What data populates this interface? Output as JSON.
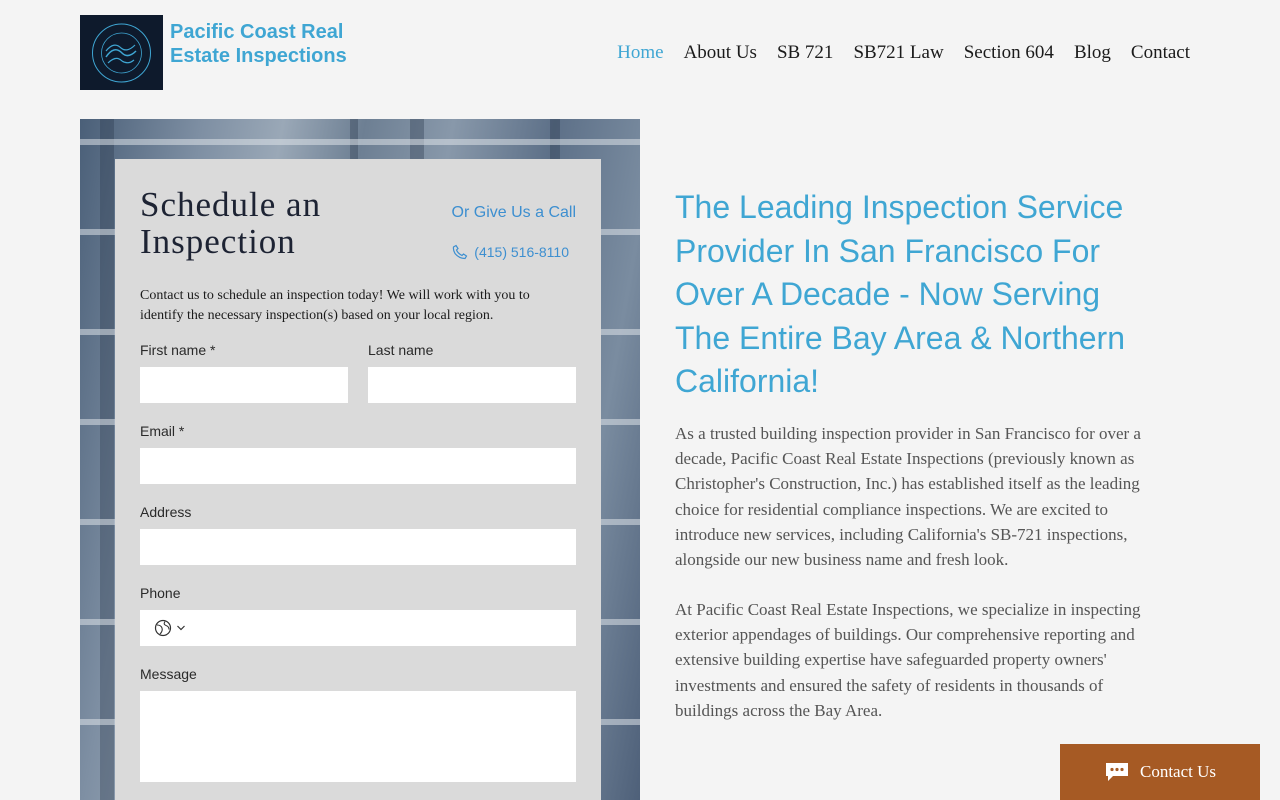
{
  "brand": {
    "name_line1": "Pacific Coast Real",
    "name_line2": "Estate Inspections",
    "logo_text": "PACIFIC COAST REAL ESTATE INSPECTIONS",
    "accent": "#3fa6d3"
  },
  "nav": [
    {
      "label": "Home",
      "active": true
    },
    {
      "label": "About Us",
      "active": false
    },
    {
      "label": "SB 721",
      "active": false
    },
    {
      "label": "SB721 Law",
      "active": false
    },
    {
      "label": "Section 604",
      "active": false
    },
    {
      "label": "Blog",
      "active": false
    },
    {
      "label": "Contact",
      "active": false
    }
  ],
  "form": {
    "title": "Schedule an Inspection",
    "call_label": "Or Give Us a Call",
    "phone": "(415) 516-8110",
    "intro": "Contact us to schedule an inspection today! We will work with you to identify the necessary inspection(s) based on your local region.",
    "first_name_label": "First name *",
    "last_name_label": "Last name",
    "email_label": "Email *",
    "address_label": "Address",
    "phone_label": "Phone",
    "message_label": "Message"
  },
  "content": {
    "headline": "The Leading Inspection Service Provider In San Francisco For Over A Decade - Now Serving The Entire Bay Area & Northern California!",
    "paragraph1": "As a trusted building inspection provider in San Francisco for over a decade, Pacific Coast Real Estate Inspections (previously known as Christopher's Construction, Inc.) has established itself as the leading choice for residential compliance inspections. We are excited to introduce new services, including California's SB-721 inspections, alongside our new business name and fresh look.",
    "paragraph2": "At Pacific Coast Real Estate Inspections, we specialize in inspecting exterior appendages of buildings. Our comprehensive reporting and extensive building expertise have safeguarded property owners' investments and ensured the safety of residents in thousands of buildings across the Bay Area."
  },
  "chat_button": {
    "label": "Contact Us",
    "color": "#a65a24"
  }
}
